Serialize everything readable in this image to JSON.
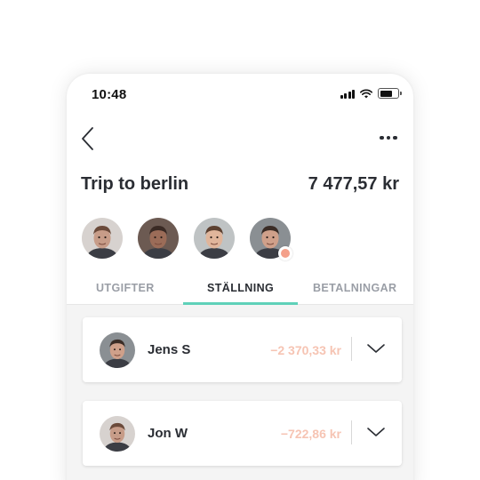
{
  "status_bar": {
    "time": "10:48"
  },
  "header": {
    "back_icon": "chevron-left-icon",
    "more_icon": "more-dots-icon"
  },
  "trip": {
    "title": "Trip to berlin",
    "total": "7 477,57 kr"
  },
  "members": [
    {
      "name": "member-1",
      "skin": "#c79c88",
      "hair": "#6b4a3a",
      "bg": "#d7d2cf"
    },
    {
      "name": "member-2",
      "skin": "#9b6c58",
      "hair": "#3a2a24",
      "bg": "#6c5a52"
    },
    {
      "name": "member-3",
      "skin": "#e0b59b",
      "hair": "#5c4030",
      "bg": "#bfc3c4"
    },
    {
      "name": "member-4",
      "skin": "#cfa08a",
      "hair": "#3a2c26",
      "bg": "#8a8f93",
      "badge": true
    }
  ],
  "tabs": [
    {
      "label": "UTGIFTER",
      "active": false
    },
    {
      "label": "STÄLLNING",
      "active": true
    },
    {
      "label": "BETALNINGAR",
      "active": false
    }
  ],
  "balances": [
    {
      "name": "Jens S",
      "amount": "−2 370,33 kr"
    },
    {
      "name": "Jon W",
      "amount": "−722,86 kr"
    }
  ],
  "colors": {
    "accent": "#5fd1b9",
    "negative_amount": "#f6c4b3",
    "text": "#2a2d33"
  }
}
